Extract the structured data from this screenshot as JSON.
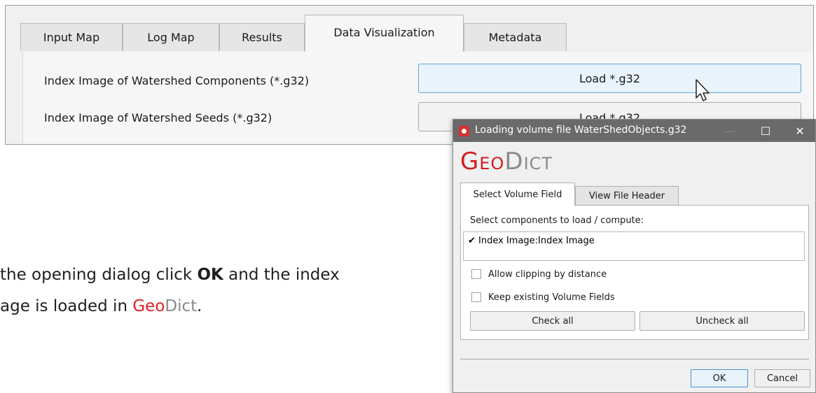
{
  "tabs": [
    {
      "label": "Input Map"
    },
    {
      "label": "Log Map"
    },
    {
      "label": "Results"
    },
    {
      "label": "Data Visualization",
      "active": true
    },
    {
      "label": "Metadata"
    }
  ],
  "rows": [
    {
      "label": "Index Image of Watershed Components (*.g32)",
      "button": "Load *.g32"
    },
    {
      "label": "Index Image of Watershed Seeds (*.g32)",
      "button": "Load *.g32"
    }
  ],
  "instruction": {
    "line1_prefix": "the opening dialog click ",
    "line1_bold": "OK",
    "line1_suffix": " and the index",
    "line2_prefix": "age is loaded in ",
    "geo": "Geo",
    "dict": "Dict",
    "line2_suffix": "."
  },
  "dialog": {
    "title": "Loading volume file WaterShedObjects.g32",
    "logo_geo": "Geo",
    "logo_dict": "Dict",
    "tabs": [
      "Select Volume Field",
      "View File Header"
    ],
    "select_label": "Select components to load / compute:",
    "list_items": [
      {
        "label": "Index Image:Index Image",
        "checked": true
      }
    ],
    "options": [
      {
        "label": "Allow clipping by distance",
        "checked": false
      },
      {
        "label": "Keep existing Volume Fields",
        "checked": false
      }
    ],
    "check_all": "Check all",
    "uncheck_all": "Uncheck all",
    "ok": "OK",
    "cancel": "Cancel",
    "minimize_glyph": "—",
    "maximize_glyph": "☐",
    "close_glyph": "✕",
    "checkmark_glyph": "✔"
  },
  "colors": {
    "brand_red": "#e02020",
    "brand_gray": "#8a8a8a",
    "titlebar": "#6a6a6a",
    "hover_blue": "#5ea6d8"
  }
}
